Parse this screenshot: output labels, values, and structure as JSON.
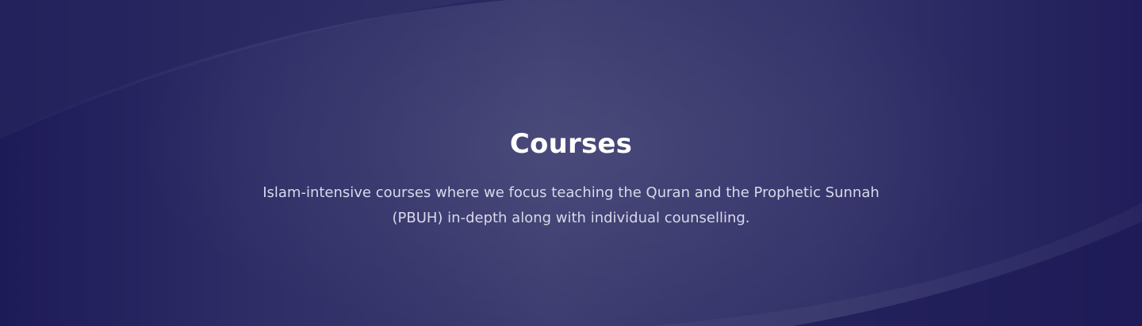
{
  "hero": {
    "title": "Courses",
    "description": "Islam-intensive courses where we focus teaching the Quran and the Prophetic Sunnah (PBUH) in-depth along with individual counselling."
  },
  "colors": {
    "background_dark": "#1d1a58",
    "background_mid": "#3c3c70",
    "title": "#ffffff",
    "description": "#d9d9ea"
  }
}
